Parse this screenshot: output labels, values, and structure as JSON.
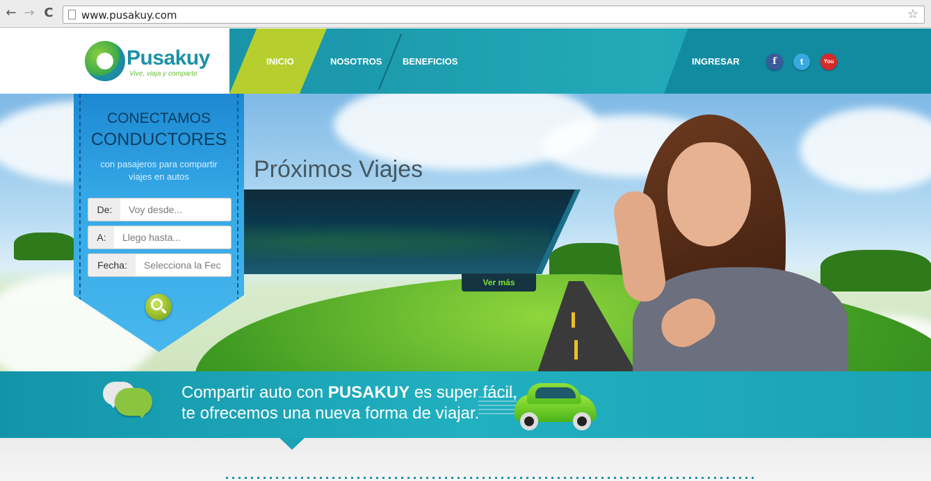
{
  "browser": {
    "url": "www.pusakuy.com",
    "back_icon": "←",
    "forward_icon": "→",
    "reload_icon": "C",
    "star_icon": "☆"
  },
  "header": {
    "logo_name": "Pusakuy",
    "logo_tagline": "Vive, viaja y comparte",
    "nav": {
      "inicio": "INICIO",
      "nosotros": "NOSOTROS",
      "beneficios": "BENEFICIOS",
      "ingresar": "INGRESAR"
    },
    "social": {
      "facebook": "f",
      "twitter": "t",
      "youtube": "You"
    }
  },
  "search_panel": {
    "title_line1": "CONECTAMOS",
    "title_line2": "CONDUCTORES",
    "subtitle_line1": "con pasajeros para compartir",
    "subtitle_line2": "viajes en autos",
    "from_label": "De:",
    "from_placeholder": "Voy desde...",
    "to_label": "A:",
    "to_placeholder": "Llego hasta...",
    "date_label": "Fecha:",
    "date_placeholder": "Selecciona la Fec"
  },
  "hero": {
    "section_title": "Próximos Viajes",
    "see_more": "Ver más"
  },
  "band": {
    "line1_prefix": "Compartir auto con ",
    "line1_brand": "PUSAKUY",
    "line1_suffix": " es super fácil,",
    "line2": "te ofrecemos una nueva forma de viajar."
  },
  "colors": {
    "teal": "#1ba2b5",
    "lime": "#b6cf2f",
    "ribbon_blue": "#35a8e6",
    "ver_mas_green": "#7fe233"
  }
}
